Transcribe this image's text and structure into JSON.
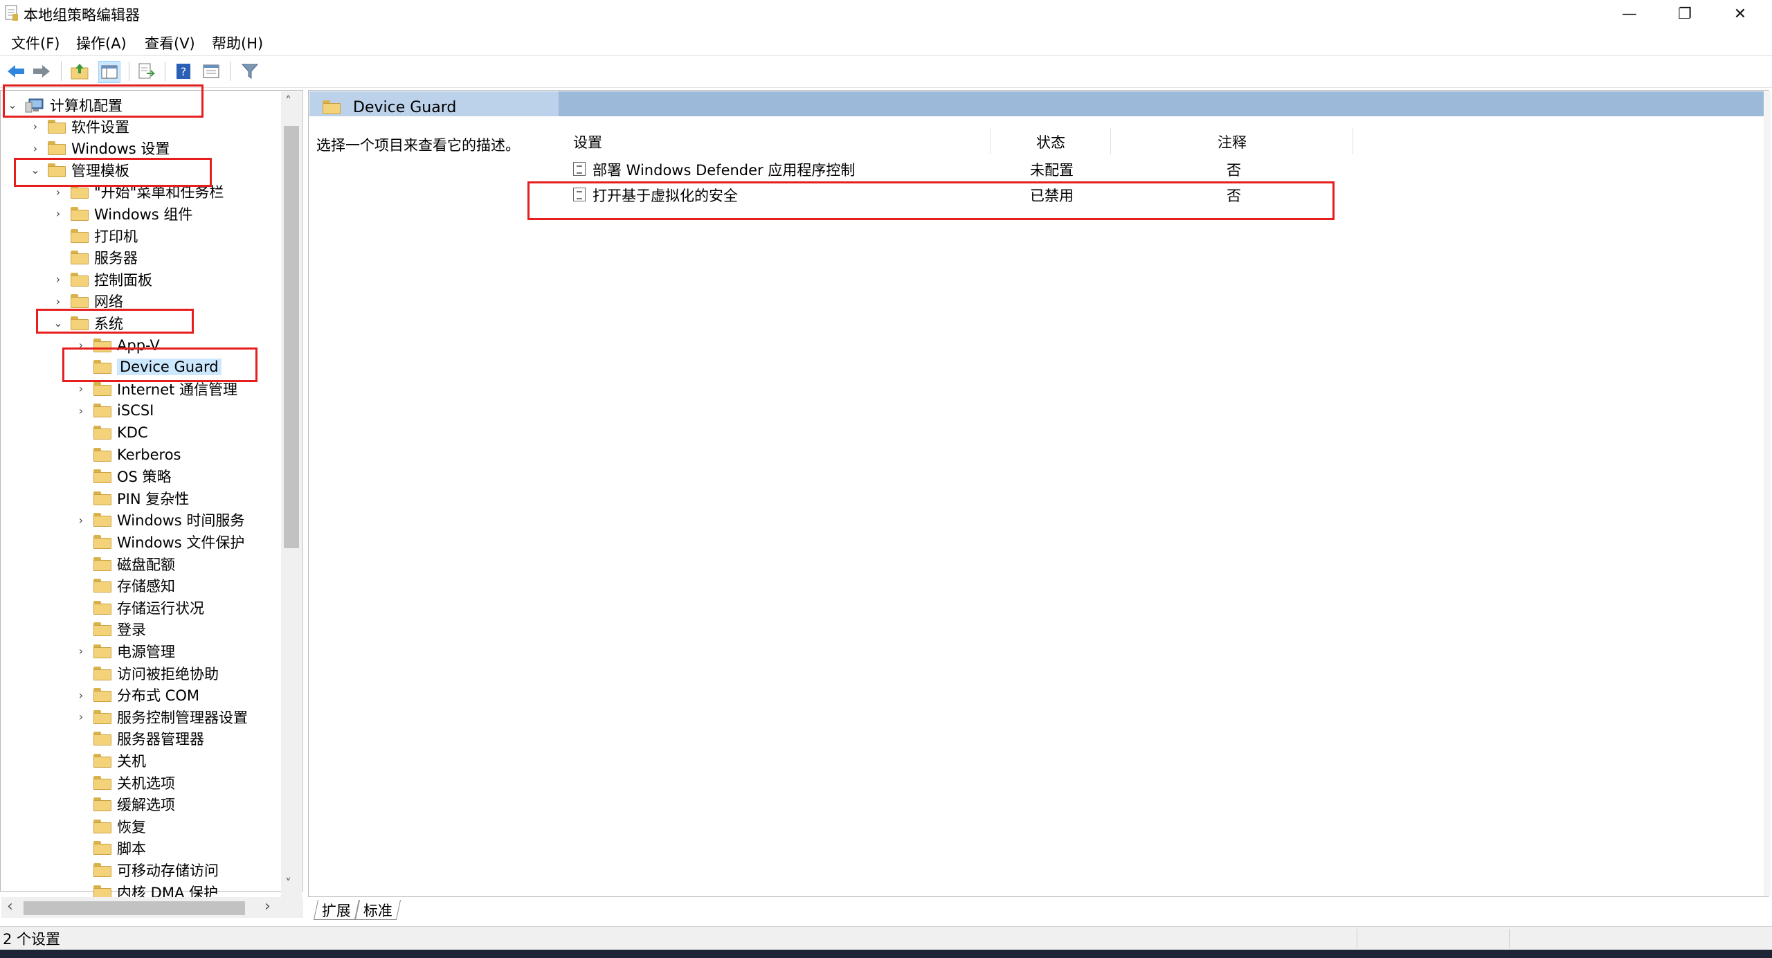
{
  "window": {
    "title": "本地组策略编辑器",
    "minimize_glyph": "—",
    "restore_glyph": "❐",
    "close_glyph": "✕"
  },
  "menu": [
    "文件(F)",
    "操作(A)",
    "查看(V)",
    "帮助(H)"
  ],
  "toolbar": {
    "icons": [
      "back-arrow-icon",
      "forward-arrow-icon",
      "up-folder-icon",
      "show-hide-tree-icon",
      "export-list-icon",
      "help-icon",
      "properties-icon",
      "filter-icon"
    ]
  },
  "tree": {
    "root": "计算机配置",
    "items": [
      {
        "label": "计算机配置",
        "expander": "⌄"
      },
      {
        "label": "软件设置",
        "expander": "›"
      },
      {
        "label": "Windows 设置",
        "expander": "›"
      },
      {
        "label": "管理模板",
        "expander": "⌄"
      },
      {
        "label": "\"开始\"菜单和任务栏",
        "expander": "›"
      },
      {
        "label": "Windows 组件",
        "expander": "›"
      },
      {
        "label": "打印机",
        "expander": ""
      },
      {
        "label": "服务器",
        "expander": ""
      },
      {
        "label": "控制面板",
        "expander": "›"
      },
      {
        "label": "网络",
        "expander": "›"
      },
      {
        "label": "系统",
        "expander": "⌄"
      },
      {
        "label": "App-V",
        "expander": "›"
      },
      {
        "label": "Device Guard",
        "expander": ""
      },
      {
        "label": "Internet 通信管理",
        "expander": "›"
      },
      {
        "label": "iSCSI",
        "expander": "›"
      },
      {
        "label": "KDC",
        "expander": ""
      },
      {
        "label": "Kerberos",
        "expander": ""
      },
      {
        "label": "OS 策略",
        "expander": ""
      },
      {
        "label": "PIN 复杂性",
        "expander": ""
      },
      {
        "label": "Windows 时间服务",
        "expander": "›"
      },
      {
        "label": "Windows 文件保护",
        "expander": ""
      },
      {
        "label": "磁盘配额",
        "expander": ""
      },
      {
        "label": "存储感知",
        "expander": ""
      },
      {
        "label": "存储运行状况",
        "expander": ""
      },
      {
        "label": "登录",
        "expander": ""
      },
      {
        "label": "电源管理",
        "expander": "›"
      },
      {
        "label": "访问被拒绝协助",
        "expander": ""
      },
      {
        "label": "分布式 COM",
        "expander": "›"
      },
      {
        "label": "服务控制管理器设置",
        "expander": "›"
      },
      {
        "label": "服务器管理器",
        "expander": ""
      },
      {
        "label": "关机",
        "expander": ""
      },
      {
        "label": "关机选项",
        "expander": ""
      },
      {
        "label": "缓解选项",
        "expander": ""
      },
      {
        "label": "恢复",
        "expander": ""
      },
      {
        "label": "脚本",
        "expander": ""
      },
      {
        "label": "可移动存储访问",
        "expander": ""
      },
      {
        "label": "内核 DMA 保护",
        "expander": ""
      }
    ],
    "scroll_up": "˄",
    "scroll_down": "˅",
    "scroll_left": "‹",
    "scroll_right": "›"
  },
  "right": {
    "title": "Device Guard",
    "description": "选择一个项目来查看它的描述。",
    "columns": {
      "setting": "设置",
      "state": "状态",
      "comment": "注释"
    },
    "rows": [
      {
        "name": "部署 Windows Defender 应用程序控制",
        "state": "未配置",
        "comment": "否"
      },
      {
        "name": "打开基于虚拟化的安全",
        "state": "已禁用",
        "comment": "否"
      }
    ]
  },
  "tabs": [
    "扩展",
    "标准"
  ],
  "status": "2 个设置"
}
